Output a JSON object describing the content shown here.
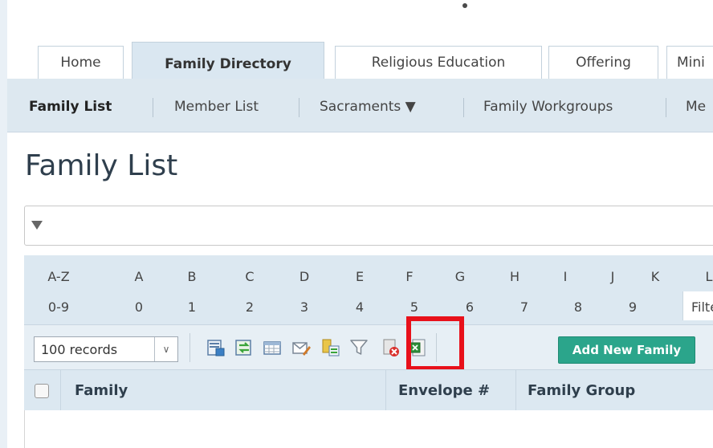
{
  "tabs": [
    {
      "label": "Home"
    },
    {
      "label": "Family Directory"
    },
    {
      "label": "Religious Education"
    },
    {
      "label": "Offering"
    },
    {
      "label": "Mini"
    }
  ],
  "subnav": [
    {
      "label": "Family List"
    },
    {
      "label": "Member List"
    },
    {
      "label": "Sacraments ▼"
    },
    {
      "label": "Family Workgroups"
    },
    {
      "label": "Me"
    }
  ],
  "page": {
    "title": "Family List"
  },
  "alpha": {
    "row1": [
      "A-Z",
      "A",
      "B",
      "C",
      "D",
      "E",
      "F",
      "G",
      "H",
      "I",
      "J",
      "K",
      "L"
    ],
    "row2": [
      "0-9",
      "0",
      "1",
      "2",
      "3",
      "4",
      "5",
      "6",
      "7",
      "8",
      "9"
    ],
    "filter_label": "Filte"
  },
  "toolbar": {
    "records_value": "100 records",
    "add_label": "Add New Family",
    "icons": [
      "report-icon",
      "refresh-icon",
      "grid-view-icon",
      "email-icon",
      "export-icon",
      "filter-icon",
      "delete-icon",
      "excel-icon"
    ]
  },
  "grid": {
    "columns": [
      "Family",
      "Envelope #",
      "Family Group"
    ]
  },
  "colors": {
    "accent": "#2ba58b",
    "highlight": "#e8101a",
    "header_bg": "#dce8f1"
  }
}
